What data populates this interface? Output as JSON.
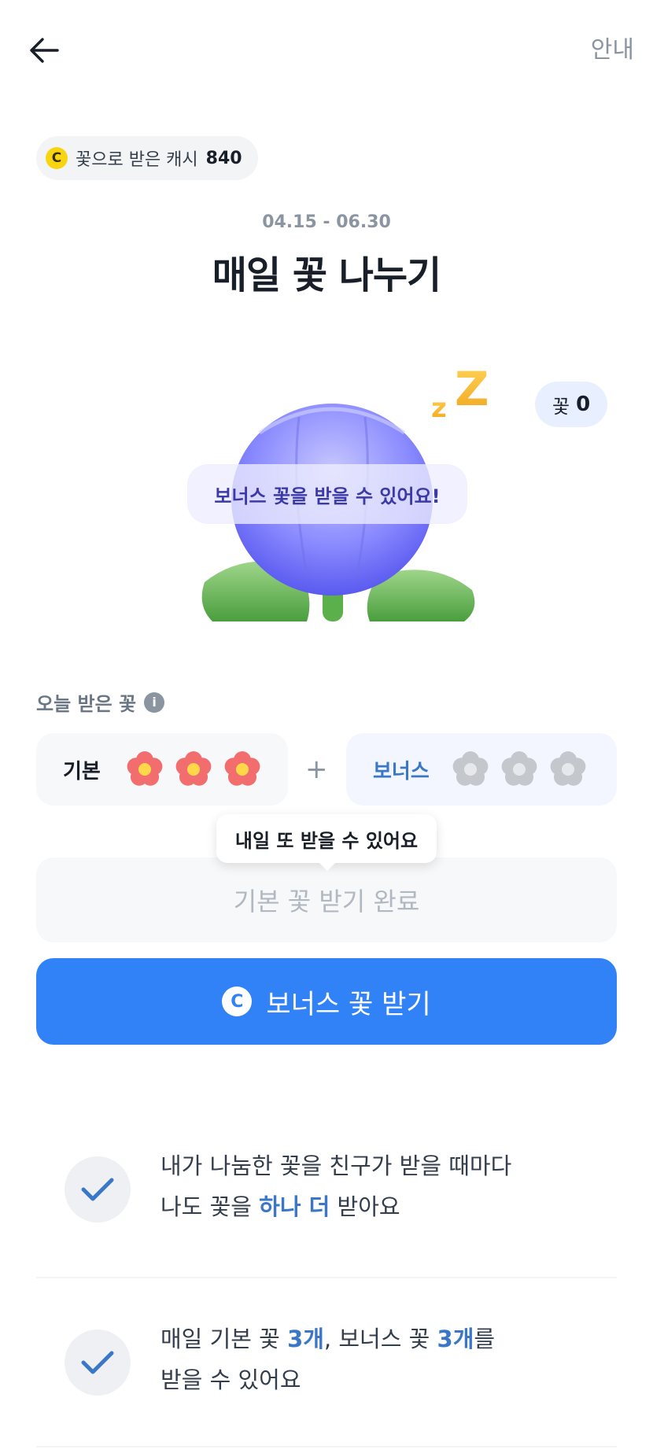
{
  "header": {
    "back_icon": "arrow-left-icon",
    "guide_label": "안내"
  },
  "cash": {
    "coin_symbol": "C",
    "label": "꽃으로 받은 캐시",
    "value": "840"
  },
  "event": {
    "period": "04.15 - 06.30",
    "title": "매일 꽃 나누기"
  },
  "hero": {
    "flower_count_label": "꽃",
    "flower_count_value": "0",
    "bonus_message": "보너스 꽃을 받을 수 있어요!",
    "illustration": "sleeping-flower-illustration"
  },
  "today": {
    "label": "오늘 받은 꽃",
    "info_icon": "info-icon",
    "basic": {
      "label": "기본",
      "received": 3,
      "total": 3
    },
    "plus_symbol": "+",
    "bonus": {
      "label": "보너스",
      "received": 0,
      "total": 3
    }
  },
  "tooltip": "내일 또 받을 수 있어요",
  "buttons": {
    "basic_done": "기본 꽃 받기 완료",
    "bonus_coin_symbol": "C",
    "bonus_receive": "보너스 꽃 받기"
  },
  "benefits": [
    {
      "line1": "내가 나눔한 꽃을 친구가 받을 때마다",
      "line2_pre": "나도 꽃을 ",
      "line2_hl": "하나 더",
      "line2_post": " 받아요"
    },
    {
      "line1_a": "매일 기본 꽃 ",
      "line1_hl1": "3개",
      "line1_b": ", 보너스 꽃 ",
      "line1_hl2": "3개",
      "line1_c": "를",
      "line2": "받을 수 있어요"
    }
  ],
  "colors": {
    "primary": "#3182f6",
    "accent_text": "#3a78c7",
    "basic_flower": "#f26d6d",
    "inactive_flower": "#c4c8cd",
    "coin": "#f9d511"
  }
}
